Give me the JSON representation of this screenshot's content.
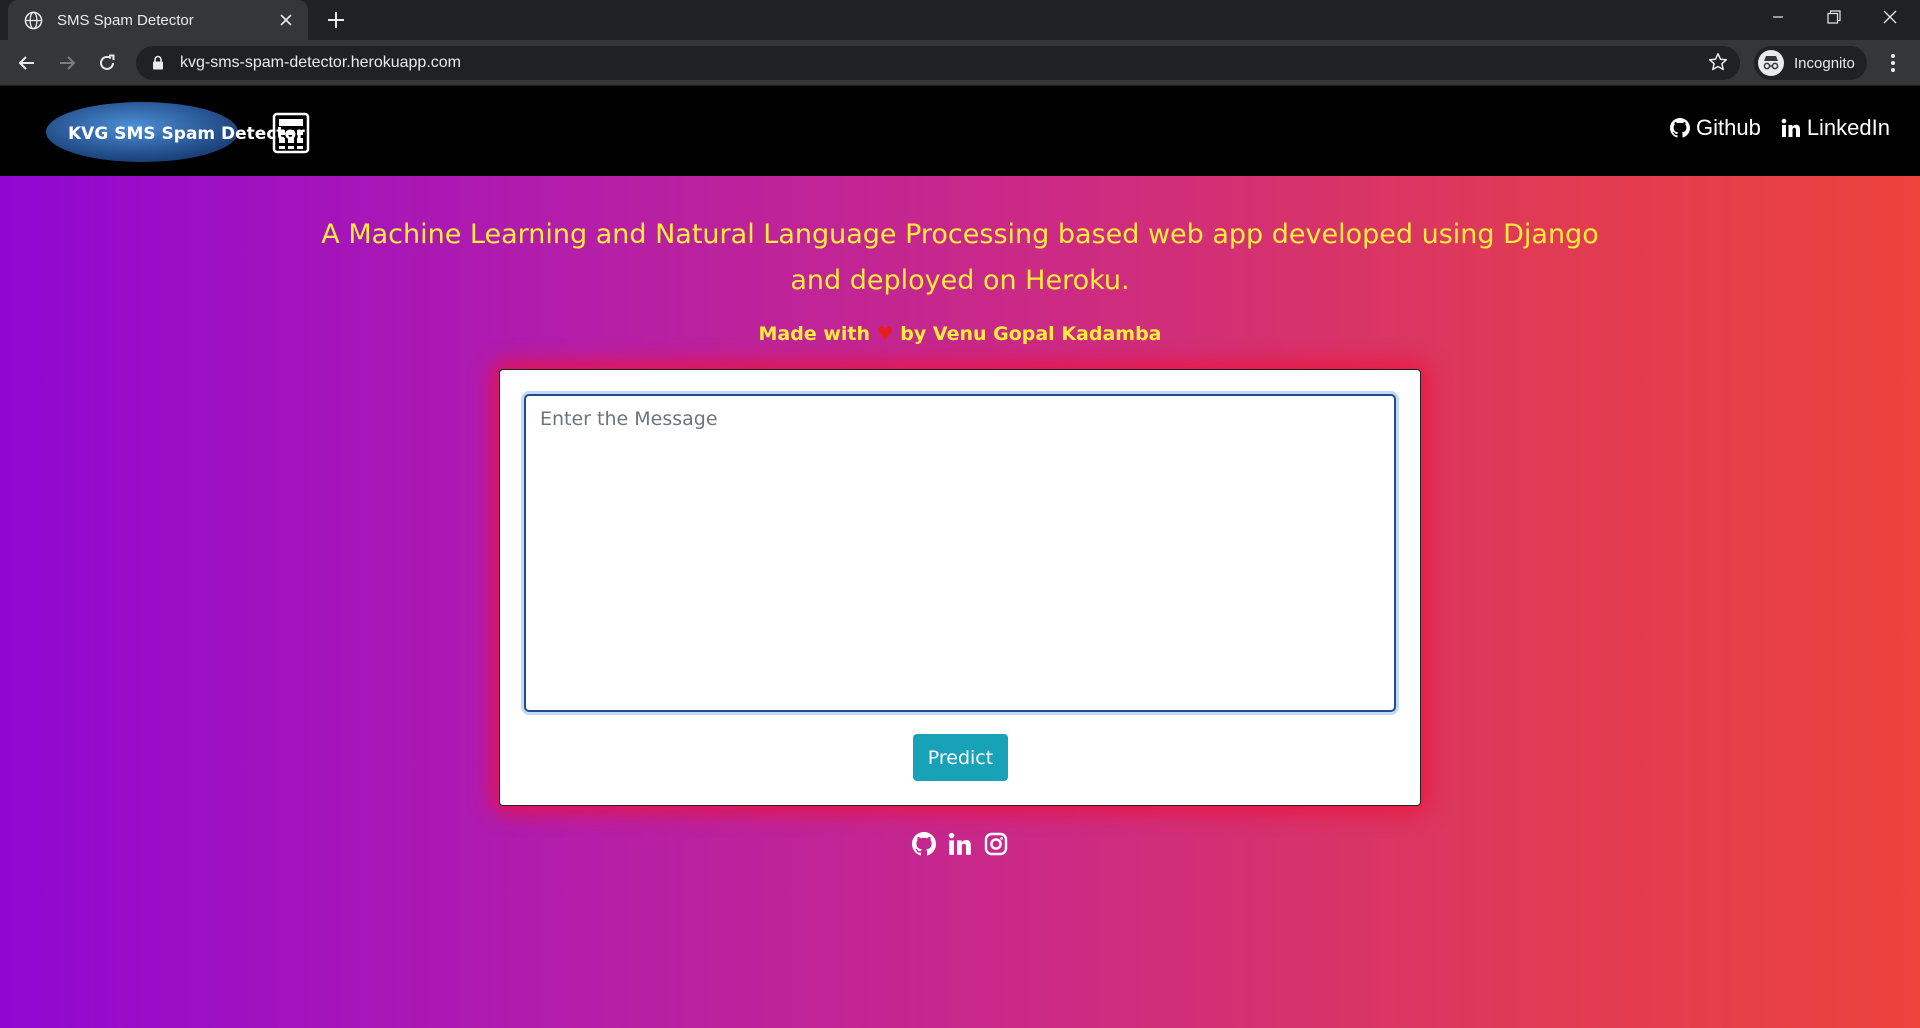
{
  "browser": {
    "tab_title": "SMS Spam Detector",
    "url": "kvg-sms-spam-detector.herokuapp.com",
    "profile_label": "Incognito",
    "icons": [
      "globe-icon",
      "close-icon",
      "plus-icon",
      "minimize-icon",
      "restore-icon",
      "close-window-icon",
      "back-icon",
      "forward-icon",
      "reload-icon",
      "lock-icon",
      "star-icon",
      "incognito-icon",
      "more-menu-icon"
    ]
  },
  "site": {
    "logo_text": "KVG SMS Spam Detector",
    "nav": {
      "github_label": "Github",
      "linkedin_label": "LinkedIn"
    },
    "tagline": "A Machine Learning and Natural Language Processing based web app developed using Django and deployed on Heroku.",
    "made_with_prefix": "Made with",
    "heart": "♥",
    "made_with_suffix": "by Venu Gopal Kadamba",
    "form": {
      "message_placeholder": "Enter the Message",
      "message_value": "",
      "predict_label": "Predict"
    },
    "footer_icons": [
      "github-icon",
      "linkedin-icon",
      "instagram-icon"
    ]
  },
  "colors": {
    "tagline": "#ffec3d",
    "heart": "#e51f1f",
    "button": "#17a2b8",
    "gradient_start": "#9007d2",
    "gradient_end": "#ec433d",
    "card_glow": "#ec143c"
  }
}
